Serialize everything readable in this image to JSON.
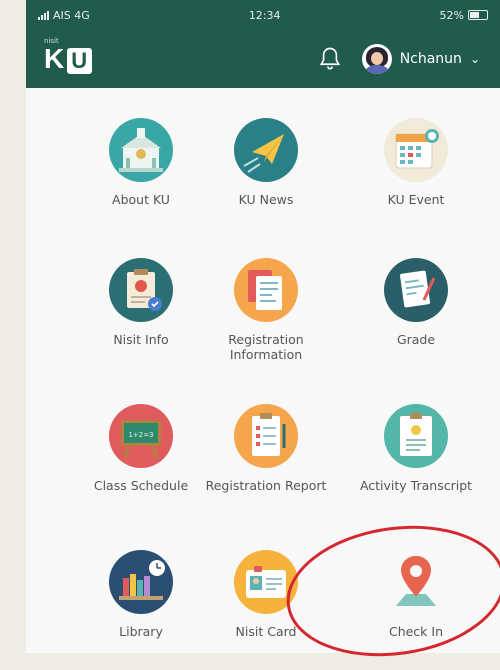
{
  "status_bar": {
    "carrier": "AIS 4G",
    "time": "12:34",
    "battery": "52%"
  },
  "header": {
    "logo_small": "nisit",
    "logo_main": "K",
    "logo_box": "U",
    "user_name": "Nchanun"
  },
  "menu": [
    {
      "label": "About KU",
      "icon": "building-icon",
      "color": "#3aa7a7"
    },
    {
      "label": "KU News",
      "icon": "paper-plane-icon",
      "color": "#2b7f86"
    },
    {
      "label": "KU Event",
      "icon": "calendar-icon",
      "color": "#f1ead9"
    },
    {
      "label": "Nisit Info",
      "icon": "clipboard-icon",
      "color": "#2b6e73"
    },
    {
      "label": "Registration Information",
      "icon": "documents-icon",
      "color": "#f5a54b"
    },
    {
      "label": "Grade",
      "icon": "grade-sheet-icon",
      "color": "#2a5f6a"
    },
    {
      "label": "Class Schedule",
      "icon": "chalkboard-icon",
      "color": "#e05b5b"
    },
    {
      "label": "Registration Report",
      "icon": "report-clipboard-icon",
      "color": "#f5a54b"
    },
    {
      "label": "Activity Transcript",
      "icon": "transcript-icon",
      "color": "#53b6a8"
    },
    {
      "label": "Library",
      "icon": "books-icon",
      "color": "#2a4f72"
    },
    {
      "label": "Nisit Card",
      "icon": "id-card-icon",
      "color": "#f5b33d"
    },
    {
      "label": "Check In",
      "icon": "location-pin-icon",
      "color": "#f7f8f7"
    }
  ]
}
